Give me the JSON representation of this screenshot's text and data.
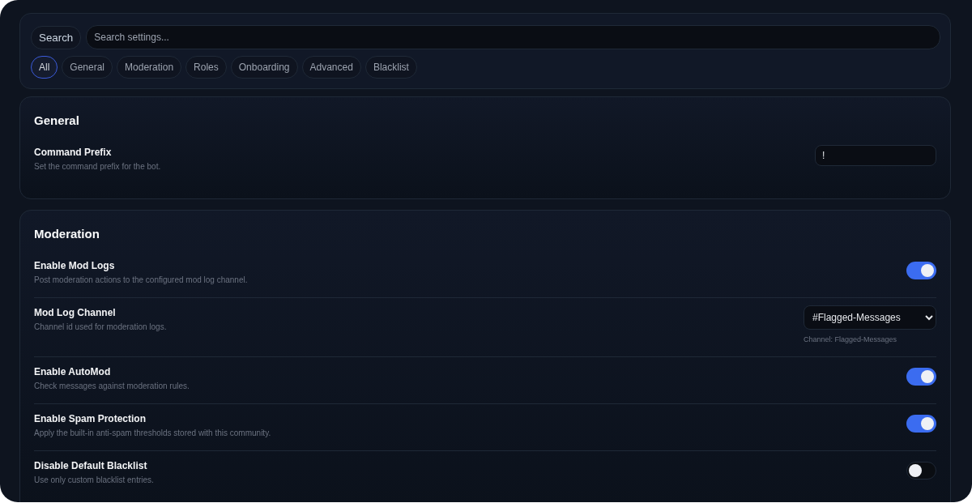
{
  "search": {
    "button": "Search",
    "placeholder": "Search settings..."
  },
  "filters": [
    {
      "label": "All",
      "selected": true
    },
    {
      "label": "General",
      "selected": false
    },
    {
      "label": "Moderation",
      "selected": false
    },
    {
      "label": "Roles",
      "selected": false
    },
    {
      "label": "Onboarding",
      "selected": false
    },
    {
      "label": "Advanced",
      "selected": false
    },
    {
      "label": "Blacklist",
      "selected": false
    }
  ],
  "sections": [
    {
      "title": "General",
      "settings": [
        {
          "kind": "text",
          "label": "Command Prefix",
          "description": "Set the command prefix for the bot.",
          "value": "!"
        }
      ]
    },
    {
      "title": "Moderation",
      "settings": [
        {
          "kind": "toggle",
          "label": "Enable Mod Logs",
          "description": "Post moderation actions to the configured mod log channel.",
          "on": true
        },
        {
          "kind": "select",
          "label": "Mod Log Channel",
          "description": "Channel id used for moderation logs.",
          "value": "#Flagged-Messages",
          "hint": "Channel: Flagged-Messages"
        },
        {
          "kind": "toggle",
          "label": "Enable AutoMod",
          "description": "Check messages against moderation rules.",
          "on": true
        },
        {
          "kind": "toggle",
          "label": "Enable Spam Protection",
          "description": "Apply the built-in anti-spam thresholds stored with this community.",
          "on": true
        },
        {
          "kind": "toggle",
          "label": "Disable Default Blacklist",
          "description": "Use only custom blacklist entries.",
          "on": false
        }
      ]
    }
  ]
}
